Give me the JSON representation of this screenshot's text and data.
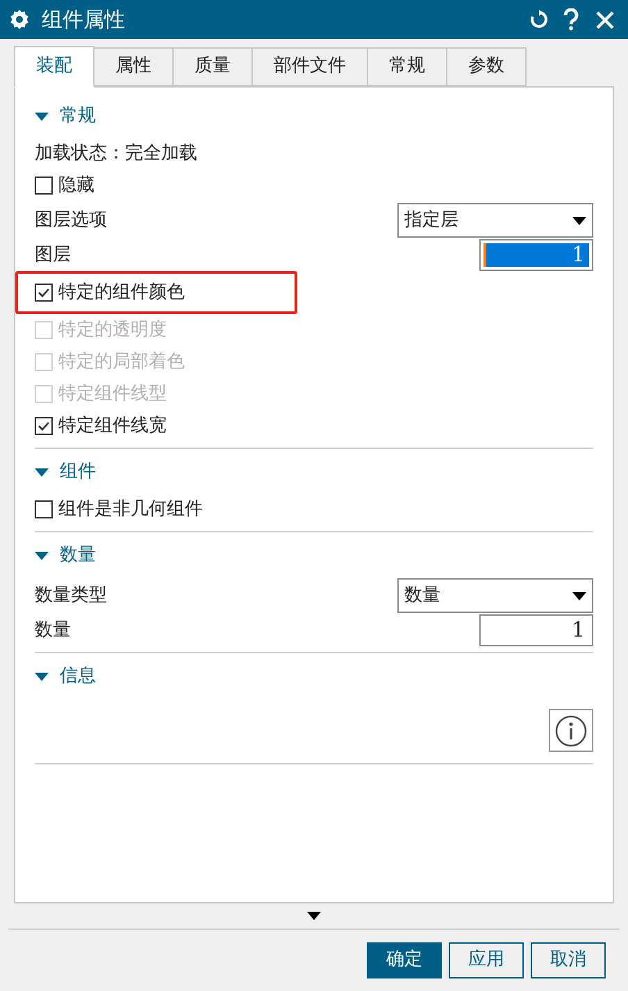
{
  "window": {
    "title": "组件属性"
  },
  "tabs": [
    {
      "label": "装配",
      "selected": true
    },
    {
      "label": "属性",
      "selected": false
    },
    {
      "label": "质量",
      "selected": false
    },
    {
      "label": "部件文件",
      "selected": false
    },
    {
      "label": "常规",
      "selected": false
    },
    {
      "label": "参数",
      "selected": false
    }
  ],
  "sections": [
    {
      "title": "常规",
      "expanded": true,
      "rows": [
        {
          "kind": "text",
          "label": "加载状态：完全加载"
        },
        {
          "kind": "checkbox",
          "label": "隐藏",
          "checked": false,
          "disabled": false,
          "highlighted": false
        },
        {
          "kind": "dropdown",
          "label": "图层选项",
          "value": "指定层"
        },
        {
          "kind": "number",
          "label": "图层",
          "value": "1",
          "selected": true
        },
        {
          "kind": "checkbox",
          "label": "特定的组件颜色",
          "checked": true,
          "disabled": false,
          "highlighted": true
        },
        {
          "kind": "checkbox",
          "label": "特定的透明度",
          "checked": false,
          "disabled": true,
          "highlighted": false
        },
        {
          "kind": "checkbox",
          "label": "特定的局部着色",
          "checked": false,
          "disabled": true,
          "highlighted": false
        },
        {
          "kind": "checkbox",
          "label": "特定组件线型",
          "checked": false,
          "disabled": true,
          "highlighted": false
        },
        {
          "kind": "checkbox",
          "label": "特定组件线宽",
          "checked": true,
          "disabled": false,
          "highlighted": false
        }
      ]
    },
    {
      "title": "组件",
      "expanded": true,
      "rows": [
        {
          "kind": "checkbox",
          "label": "组件是非几何组件",
          "checked": false,
          "disabled": false,
          "highlighted": false
        }
      ]
    },
    {
      "title": "数量",
      "expanded": true,
      "rows": [
        {
          "kind": "dropdown",
          "label": "数量类型",
          "value": "数量"
        },
        {
          "kind": "number",
          "label": "数量",
          "value": "1",
          "selected": false
        }
      ]
    },
    {
      "title": "信息",
      "expanded": true,
      "rows": [
        {
          "kind": "info"
        }
      ]
    }
  ],
  "buttons": [
    {
      "label": "确定",
      "primary": true
    },
    {
      "label": "应用",
      "primary": false
    },
    {
      "label": "取消",
      "primary": false
    }
  ]
}
